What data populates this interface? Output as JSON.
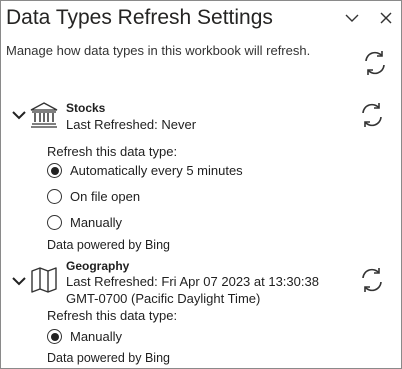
{
  "header": {
    "title": "Data Types Refresh Settings",
    "subtitle": "Manage how data types in this workbook will refresh."
  },
  "sections": [
    {
      "name": "Stocks",
      "last_refreshed": "Last Refreshed: Never",
      "refresh_label": "Refresh this data type:",
      "options": [
        {
          "label": "Automatically every 5 minutes",
          "selected": true
        },
        {
          "label": "On file open",
          "selected": false
        },
        {
          "label": "Manually",
          "selected": false
        }
      ],
      "powered_by": "Data powered by Bing"
    },
    {
      "name": "Geography",
      "last_refreshed_line1": "Last Refreshed: Fri Apr 07 2023 at 13:30:38",
      "last_refreshed_line2": "GMT-0700 (Pacific Daylight Time)",
      "refresh_label": "Refresh this data type:",
      "options": [
        {
          "label": "Manually",
          "selected": true
        }
      ],
      "powered_by": "Data powered by Bing"
    }
  ]
}
